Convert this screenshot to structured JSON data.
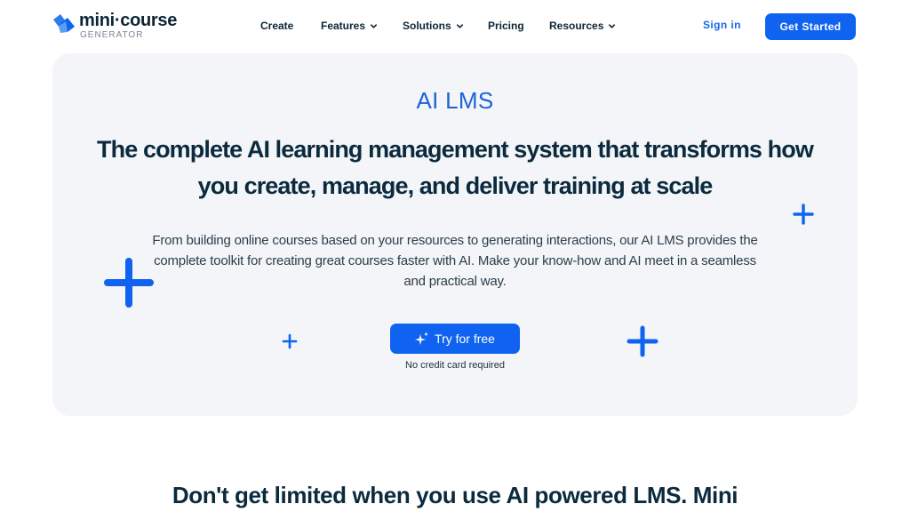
{
  "header": {
    "logo": {
      "name": "mini·course",
      "sub": "GENERATOR"
    },
    "nav": [
      {
        "label": "Create",
        "has_dropdown": false
      },
      {
        "label": "Features",
        "has_dropdown": true
      },
      {
        "label": "Solutions",
        "has_dropdown": true
      },
      {
        "label": "Pricing",
        "has_dropdown": false
      },
      {
        "label": "Resources",
        "has_dropdown": true
      }
    ],
    "sign_in": "Sign in",
    "get_started": "Get Started"
  },
  "hero": {
    "eyebrow": "AI LMS",
    "headline": "The complete AI learning management system that transforms how you create, manage, and deliver training at scale",
    "description": "From building online courses based on your resources to generating interactions, our AI LMS provides the complete toolkit for creating great courses faster with AI. Make your know-how and AI meet in a seamless and practical way.",
    "cta": "Try for free",
    "cta_note": "No credit card required"
  },
  "section": {
    "title": "Don't get limited when you use AI powered LMS. Mini"
  },
  "colors": {
    "brand_blue": "#0f63f0",
    "accent_text": "#1e63d6",
    "heading": "#0b2a3d",
    "hero_bg": "#f3f5f8"
  },
  "icons": [
    "logo-mark-icon",
    "chevron-down-icon",
    "sparkle-icon",
    "plus-icon"
  ]
}
